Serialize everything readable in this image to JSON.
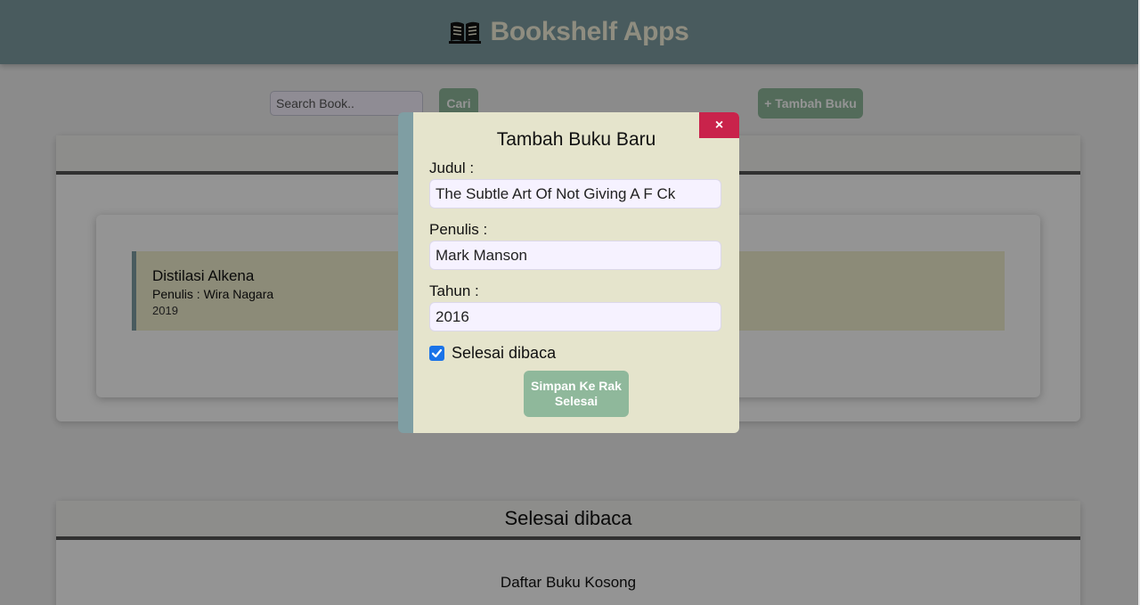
{
  "header": {
    "title": "Bookshelf Apps",
    "icon": "open-book-icon"
  },
  "toolbar": {
    "search_placeholder": "Search Book..",
    "search_button": "Cari",
    "add_button": "+ Tambah Buku"
  },
  "unread_section": {
    "title": "",
    "books": [
      {
        "title": "Distilasi Alkena",
        "author": "Penulis : Wira Nagara",
        "year": "2019"
      }
    ]
  },
  "read_section": {
    "title": "Selesai dibaca",
    "empty_text": "Daftar Buku Kosong"
  },
  "modal": {
    "title": "Tambah Buku Baru",
    "close_label": "×",
    "fields": {
      "judul_label": "Judul :",
      "judul_value": "The Subtle Art Of Not Giving A F Ck",
      "penulis_label": "Penulis :",
      "penulis_value": "Mark Manson",
      "tahun_label": "Tahun :",
      "tahun_value": "2016"
    },
    "checkbox_label": "Selesai dibaca",
    "checkbox_checked": true,
    "submit_label": "Simpan Ke Rak Selesai"
  },
  "colors": {
    "header_bg": "#7f9ea3",
    "button_green": "#8fb89b",
    "modal_bg": "#e5e4cc",
    "close_red": "#c9234b",
    "book_item_bg": "#f2efcf"
  }
}
